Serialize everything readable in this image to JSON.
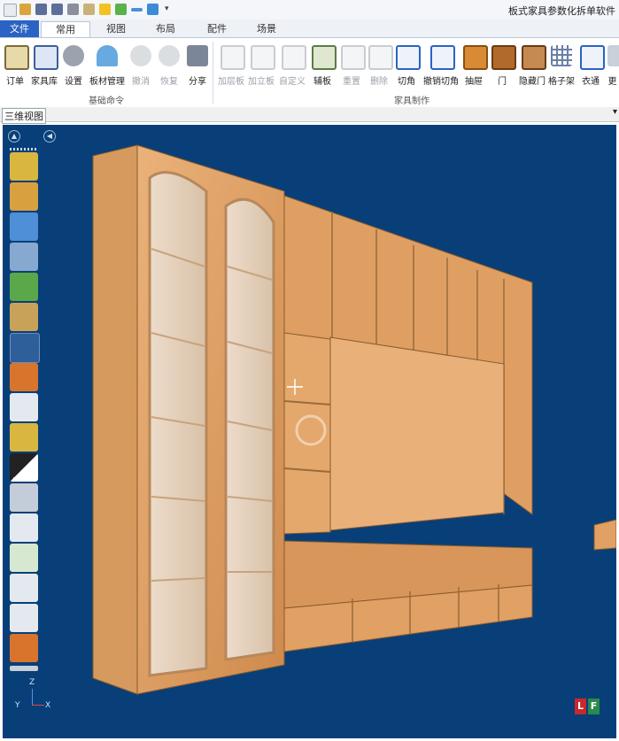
{
  "app_title": "板式家具参数化拆单软件",
  "quick_access": [
    "new-icon",
    "open-icon",
    "save-icon",
    "save-as-icon",
    "print-icon",
    "preview-icon",
    "star-icon",
    "refresh-icon",
    "line-icon",
    "box-icon"
  ],
  "tabs": [
    {
      "id": "file",
      "label": "文件"
    },
    {
      "id": "common",
      "label": "常用"
    },
    {
      "id": "view",
      "label": "视图"
    },
    {
      "id": "layout",
      "label": "布局"
    },
    {
      "id": "parts",
      "label": "配件"
    },
    {
      "id": "scene",
      "label": "场景"
    }
  ],
  "ribbon": {
    "group_basic": "基础命令",
    "group_furniture": "家具制作",
    "basic_buttons": [
      {
        "label": "订单",
        "icon": "clipboard-icon",
        "enabled": true
      },
      {
        "label": "家具库",
        "icon": "library-icon",
        "enabled": true
      },
      {
        "label": "设置",
        "icon": "gear-icon",
        "enabled": true
      },
      {
        "label": "板材管理",
        "icon": "boards-icon",
        "enabled": true
      },
      {
        "label": "撤消",
        "icon": "undo-icon",
        "enabled": false
      },
      {
        "label": "恢复",
        "icon": "redo-icon",
        "enabled": false
      },
      {
        "label": "分享",
        "icon": "share-icon",
        "enabled": true
      }
    ],
    "furniture_buttons": [
      {
        "label": "加层板",
        "icon": "add-shelf-icon",
        "enabled": false
      },
      {
        "label": "加立板",
        "icon": "add-vertical-icon",
        "enabled": false
      },
      {
        "label": "自定义",
        "icon": "custom-icon",
        "enabled": false
      },
      {
        "label": "辅板",
        "icon": "aux-board-icon",
        "enabled": true
      },
      {
        "label": "重置",
        "icon": "reset-icon",
        "enabled": false
      },
      {
        "label": "删除",
        "icon": "delete-icon",
        "enabled": false
      },
      {
        "label": "切角",
        "icon": "chamfer-icon",
        "enabled": true
      },
      {
        "label": "撤销切角",
        "icon": "undo-chamfer-icon",
        "enabled": true
      },
      {
        "label": "抽屉",
        "icon": "drawer-icon",
        "enabled": true
      },
      {
        "label": "门",
        "icon": "door-icon",
        "enabled": true
      },
      {
        "label": "隐藏门",
        "icon": "hide-door-icon",
        "enabled": true
      },
      {
        "label": "格子架",
        "icon": "grid-rack-icon",
        "enabled": true
      },
      {
        "label": "衣通",
        "icon": "rail-icon",
        "enabled": true
      },
      {
        "label": "更",
        "icon": "more-icon",
        "enabled": true
      }
    ]
  },
  "view_title": "三维视图",
  "viewport": {
    "background": "#083f78",
    "side_tools": [
      "puzzle-add-icon",
      "puzzle-remove-icon",
      "rotate-icon",
      "zoom-icon",
      "fit-icon",
      "measure-icon",
      "wireframe-icon",
      "texture-icon",
      "warning-icon",
      "boxes-icon",
      "contrast-icon",
      "camera-icon",
      "copy-icon",
      "export-icon",
      "search-doc-icon",
      "layers-icon",
      "dxf-icon"
    ],
    "axis": {
      "z": "Z",
      "y": "Y",
      "x": "X"
    },
    "logo": "LF"
  }
}
